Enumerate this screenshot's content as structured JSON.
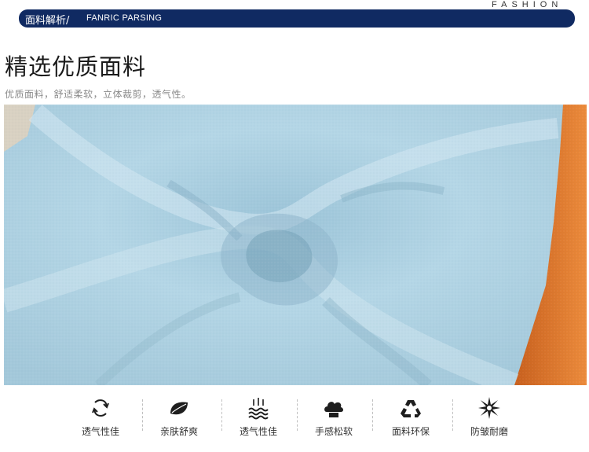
{
  "header": {
    "brand_word": "FASHION",
    "section_cn": "面料解析/",
    "section_en": "FANRIC PARSING"
  },
  "main": {
    "title": "精选优质面料",
    "subtitle": "优质面料，舒适柔软，立体裁剪，透气性。"
  },
  "features": [
    {
      "icon": "breathable-swirl-icon",
      "label": "透气性佳"
    },
    {
      "icon": "leaf-icon",
      "label": "亲肤舒爽"
    },
    {
      "icon": "water-waves-icon",
      "label": "透气性佳"
    },
    {
      "icon": "soft-cloud-icon",
      "label": "手感松软"
    },
    {
      "icon": "recycle-icon",
      "label": "面料环保"
    },
    {
      "icon": "wrinkle-resistant-star-icon",
      "label": "防皱耐磨"
    }
  ],
  "colors": {
    "header_bar": "#102a62",
    "fabric_blue": "#a9cee0",
    "fabric_orange": "#e07a2f",
    "icon": "#1e1e1e"
  }
}
